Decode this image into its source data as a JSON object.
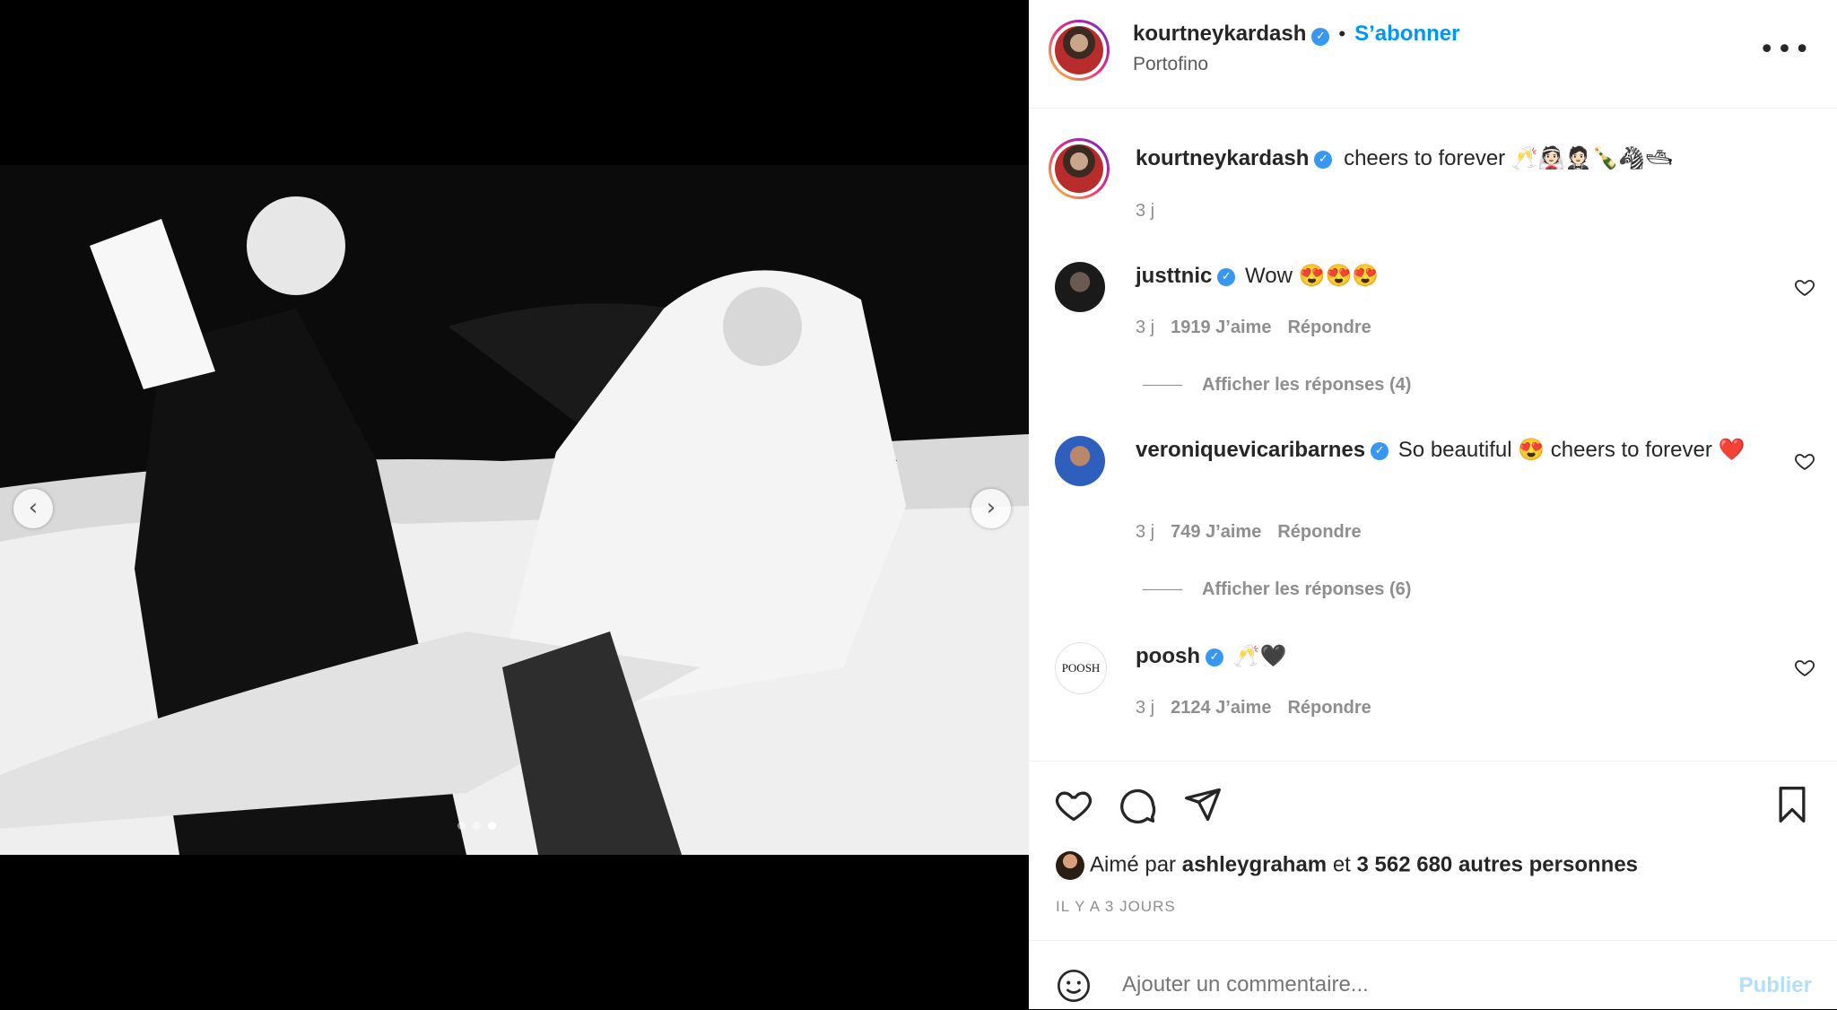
{
  "post": {
    "username": "kourtneykardash",
    "follow_label": "S’abonner",
    "separator": "•",
    "location": "Portofino",
    "more_label": "•••",
    "caption_text": "cheers to forever 🥂👰🏻🤵🏻🍾🦓🛥",
    "caption_time": "3 j"
  },
  "carousel": {
    "prev": "‹",
    "next": "›",
    "dots": 3,
    "active_dot": 3
  },
  "comments": [
    {
      "username": "justtnic",
      "text": "Wow 😍😍😍",
      "time": "3 j",
      "likes": "1919 J’aime",
      "reply": "Répondre",
      "view_replies": "Afficher les réponses (4)"
    },
    {
      "username": "veroniquevicaribarnes",
      "text": "So beautiful 😍 cheers to forever ❤️",
      "time": "3 j",
      "likes": "749 J’aime",
      "reply": "Répondre",
      "view_replies": "Afficher les réponses (6)"
    },
    {
      "username": "poosh",
      "text": "🥂🖤",
      "time": "3 j",
      "likes": "2124 J’aime",
      "reply": "Répondre",
      "avatar_text": "POOSH"
    }
  ],
  "likes": {
    "prefix": "Aimé par",
    "liker": "ashleygraham",
    "middle": "et",
    "others": "3 562 680 autres personnes"
  },
  "date": "IL Y A 3 JOURS",
  "comment_input": {
    "placeholder": "Ajouter un commentaire...",
    "publish": "Publier"
  },
  "verified_mark": "✓",
  "colors": {
    "link": "#0095f6",
    "verified": "#3897f0",
    "muted": "#8e8e8e",
    "publish_disabled": "#b2dffc"
  }
}
